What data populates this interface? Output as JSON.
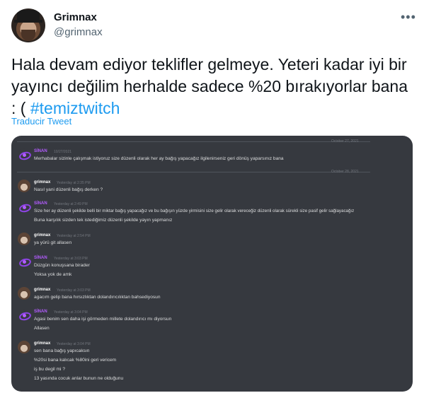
{
  "tweet": {
    "author_name": "Grimnax",
    "author_handle": "@grimnax",
    "more_icon": "more-horizontal-icon",
    "text": "Hala devam ediyor teklifler gelmeye. Yeteri kadar iyi bir yayıncı değilim herhalde sadece %20 bırakıyorlar bana : ( ",
    "hashtag": "#temiztwitch",
    "translate_label": "Traducir Tweet"
  },
  "discord": {
    "dividers": [
      "October 27, 2021",
      "October 28, 2021"
    ],
    "messages": [
      {
        "author": "SİNAN",
        "time": "10/27/2021",
        "lines": [
          "Merhabalar sizinle çalışmak istiyoruz size düzenli olarak her ay bağış yapacağız ilgilenirseniz geri dönüş yaparsınız bana"
        ]
      },
      {
        "author": "grimnax",
        "time": "Yesterday at 2:35 PM",
        "lines": [
          "Nasıl yani düzenli bağış derken ?"
        ]
      },
      {
        "author": "SİNAN",
        "time": "Yesterday at 2:49 PM",
        "lines": [
          "Size her ay düzenli şekilde belli bir miktar bağış yapacağız ve bu bağışın yüzde yirmisini size gelir olarak vereceğiz düzenli olarak sürekli size pasif gelir sağlayacağız",
          "Buna karşılık sizden tek istediğimiz düzenli şekilde yayın yapmanız"
        ]
      },
      {
        "author": "grimnax",
        "time": "Yesterday at 2:54 PM",
        "lines": [
          "ya yürü git allasen"
        ]
      },
      {
        "author": "SİNAN",
        "time": "Yesterday at 3:03 PM",
        "lines": [
          "Düzgün konuşsana birader",
          "Yoksa yok de amk"
        ]
      },
      {
        "author": "grimnax",
        "time": "Yesterday at 3:03 PM",
        "lines": [
          "agacım gelip bana hırsızlıktan dolandırıcılıktan bahsediyosun"
        ]
      },
      {
        "author": "SİNAN",
        "time": "Yesterday at 3:04 PM",
        "lines": [
          "Agasi benim sen daha işi görmeden millete dolandırıcı mı diyorsun",
          "Allasen"
        ]
      },
      {
        "author": "grimnax",
        "time": "Yesterday at 3:04 PM",
        "lines": [
          "sen bana bağış yapıcaksın",
          "%20si bana kalıcak %80ini geri vericem",
          "iş bu degil mi ?",
          "13 yasında cocuk anlar bunun ne olduğunu"
        ]
      }
    ]
  },
  "colors": {
    "hashtag": "#1d9bf0",
    "discord_bg": "#36393f",
    "sinan_name": "#b35cff",
    "message_text": "#dcddde"
  }
}
